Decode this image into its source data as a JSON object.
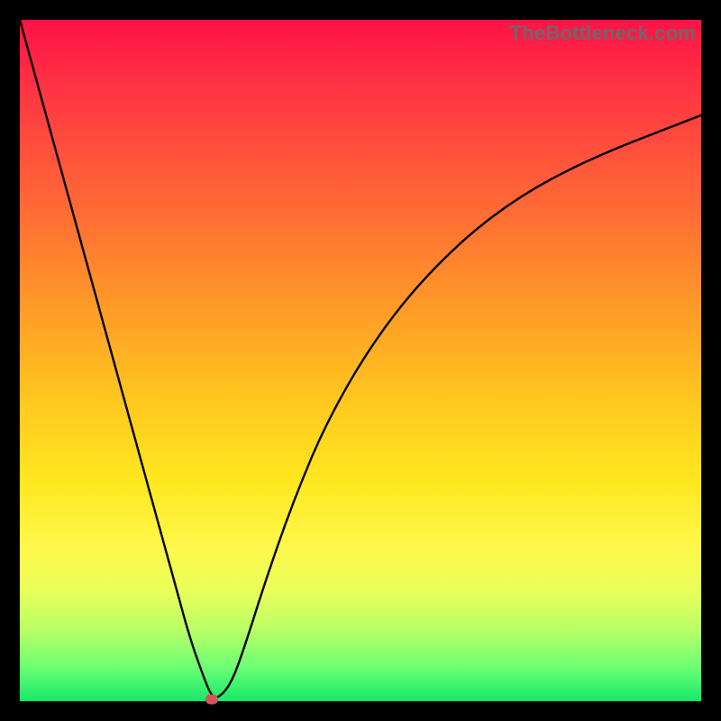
{
  "attribution": "TheBottleneck.com",
  "colors": {
    "frame": "#000000",
    "curve_stroke": "#000000",
    "marker_fill": "#d1555a"
  },
  "chart_data": {
    "type": "line",
    "title": "",
    "xlabel": "",
    "ylabel": "",
    "xlim": [
      0,
      100
    ],
    "ylim": [
      0,
      100
    ],
    "grid": false,
    "legend": false,
    "series": [
      {
        "name": "bottleneck-curve",
        "x": [
          0,
          4,
          8,
          12,
          16,
          20,
          23,
          25,
          27,
          28,
          29,
          31,
          33,
          36,
          40,
          45,
          52,
          60,
          70,
          82,
          100
        ],
        "values": [
          100,
          85.5,
          70.9,
          56.4,
          41.8,
          27.3,
          16.4,
          9.1,
          3.5,
          1.0,
          0.3,
          2.5,
          8.0,
          17.5,
          29.0,
          41.0,
          53.0,
          63.0,
          72.0,
          79.0,
          86.0
        ]
      }
    ],
    "marker": {
      "x": 28.2,
      "y": 0.2
    }
  }
}
